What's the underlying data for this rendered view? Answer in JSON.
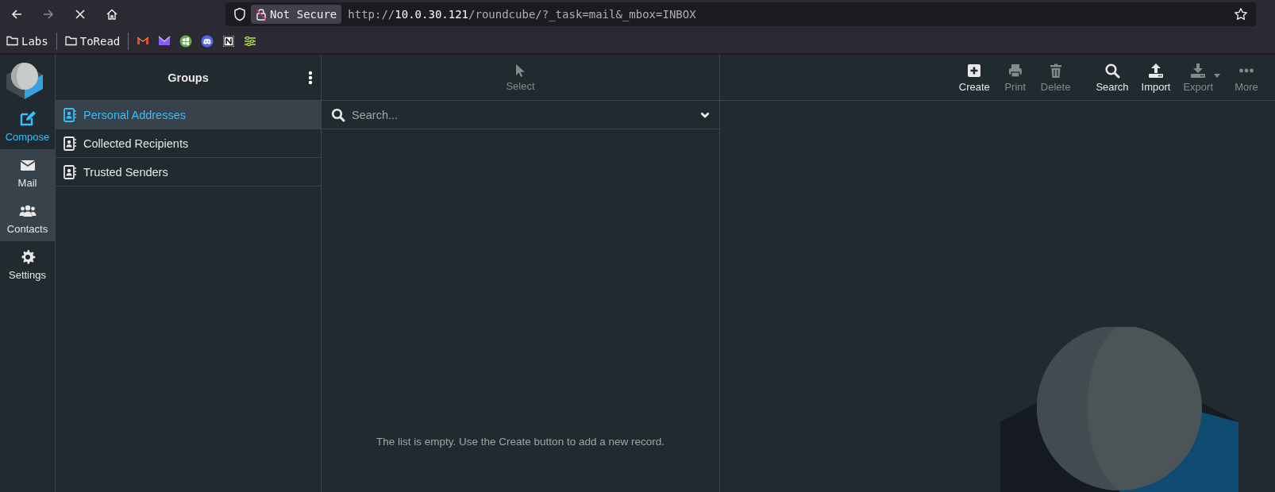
{
  "browser": {
    "security_label": "Not Secure",
    "url": {
      "scheme": "http://",
      "host": "10.0.30.121",
      "path": "/roundcube/?_task=mail&_mbox=INBOX"
    },
    "bookmarks": [
      {
        "kind": "folder",
        "label": "Labs"
      },
      {
        "kind": "folder",
        "label": "ToRead"
      },
      {
        "kind": "icon"
      },
      {
        "kind": "icon"
      },
      {
        "kind": "icon"
      },
      {
        "kind": "icon"
      },
      {
        "kind": "icon"
      },
      {
        "kind": "icon"
      }
    ]
  },
  "nav": [
    {
      "kind": "compose",
      "label": "Compose",
      "selected": false
    },
    {
      "kind": "mail",
      "label": "Mail",
      "selected": true
    },
    {
      "kind": "contacts",
      "label": "Contacts",
      "selected": true
    },
    {
      "kind": "settings",
      "label": "Settings",
      "selected": false
    }
  ],
  "groups": {
    "title": "Groups",
    "items": [
      {
        "label": "Personal Addresses",
        "selected": true
      },
      {
        "label": "Collected Recipients",
        "selected": false
      },
      {
        "label": "Trusted Senders",
        "selected": false
      }
    ]
  },
  "list": {
    "select_label": "Select",
    "select_disabled": true,
    "search": {
      "placeholder": "Search..."
    },
    "empty_message": "The list is empty. Use the Create button to add a new record."
  },
  "toolbar": [
    {
      "kind": "create",
      "label": "Create",
      "disabled": false
    },
    {
      "kind": "print",
      "label": "Print",
      "disabled": true
    },
    {
      "kind": "delete",
      "label": "Delete",
      "disabled": true
    },
    {
      "kind": "search",
      "label": "Search",
      "disabled": false
    },
    {
      "kind": "import",
      "label": "Import",
      "disabled": false
    },
    {
      "kind": "export",
      "label": "Export",
      "disabled": true
    },
    {
      "kind": "more",
      "label": "More",
      "disabled": true
    }
  ]
}
